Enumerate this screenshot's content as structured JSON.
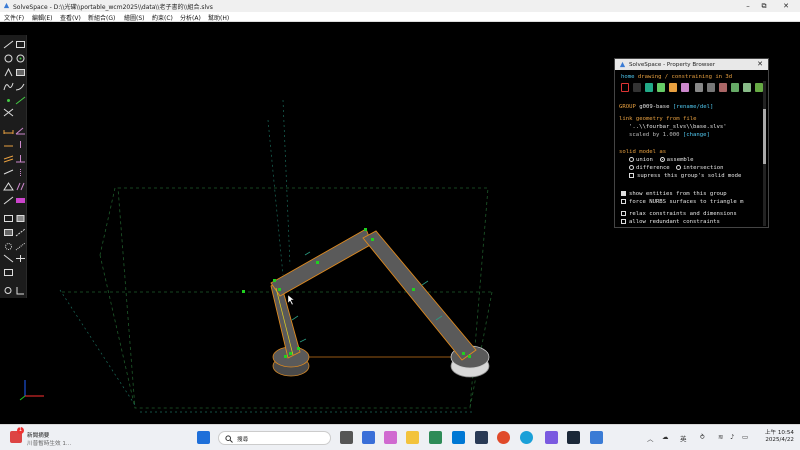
{
  "window": {
    "title": "SolveSpace - D:\\\\光碟\\\\portable_wcm2025\\\\data\\\\老子書的\\\\組合.slvs",
    "minimize": "–",
    "maximize": "⧉",
    "close": "✕"
  },
  "menu": [
    "文件(F)",
    "編輯(E)",
    "查看(V)",
    "新組合(G)",
    "繪圖(S)",
    "約束(C)",
    "分析(A)",
    "幫助(H)"
  ],
  "property_browser": {
    "title": "SolveSpace - Property Browser",
    "nav_home": "home",
    "nav_sep": "  ",
    "nav_status": "drawing / constraining in 3d",
    "group_label": "GROUP",
    "group_name": "g009-base",
    "group_actions": "[rename/del]",
    "link_label": "link geometry from file",
    "link_file": "'..\\\\fourbar_slvs\\\\base.slvs'",
    "scaled_by": "scaled by 1.000",
    "scaled_action": "[change]",
    "solid_label": "solid model as",
    "opt_union": "union",
    "opt_assemble": "assemble",
    "opt_difference": "difference",
    "opt_intersection": "intersection",
    "suppress": "supress this group's solid mode",
    "show_entities": "show entities from this group",
    "force_nurbs": "force NURBS surfaces to triangle m",
    "relax": "relax constraints and dimensions",
    "allow_redundant": "allow redundant constraints"
  },
  "taskbar": {
    "notification_badge": "1",
    "notification_title": "新聞摘要",
    "notification_sub": "川普暫時生效 1...",
    "search_placeholder": "搜尋",
    "ime": "英",
    "time": "上午 10:54",
    "date": "2025/4/22"
  },
  "colors": {
    "link_fill": "#5a5a5a",
    "link_outline": "#e08a1e",
    "point": "#20d020",
    "constraint": "#2a9a80",
    "workplane": "#1e5a2a"
  }
}
